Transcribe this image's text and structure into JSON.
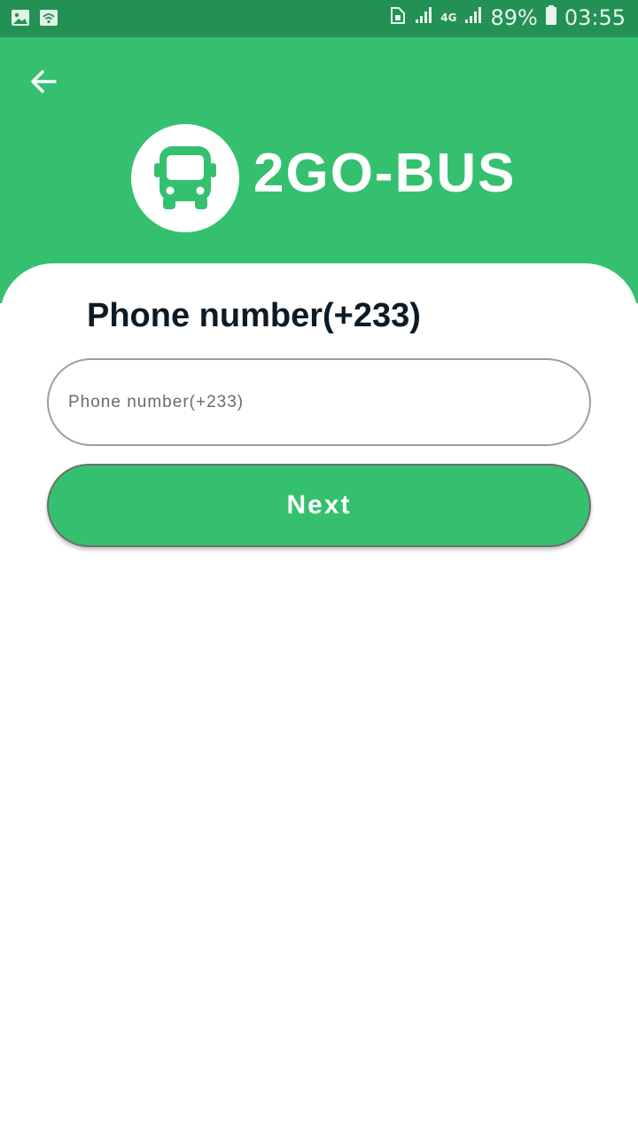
{
  "status_bar": {
    "battery": "89%",
    "time": "03:55",
    "network": "4G",
    "icons": [
      "image-icon",
      "wifi-icon",
      "sim-icon",
      "signal-icon",
      "signal-icon",
      "battery-icon"
    ]
  },
  "header": {
    "brand": "2GO-BUS",
    "background_color": "#35c06f",
    "back_icon": "arrow-left-icon",
    "logo_icon": "bus-icon"
  },
  "form": {
    "title": "Phone number(+233)",
    "phone_placeholder": "Phone number(+233)",
    "phone_value": "",
    "next_label": "Next"
  }
}
